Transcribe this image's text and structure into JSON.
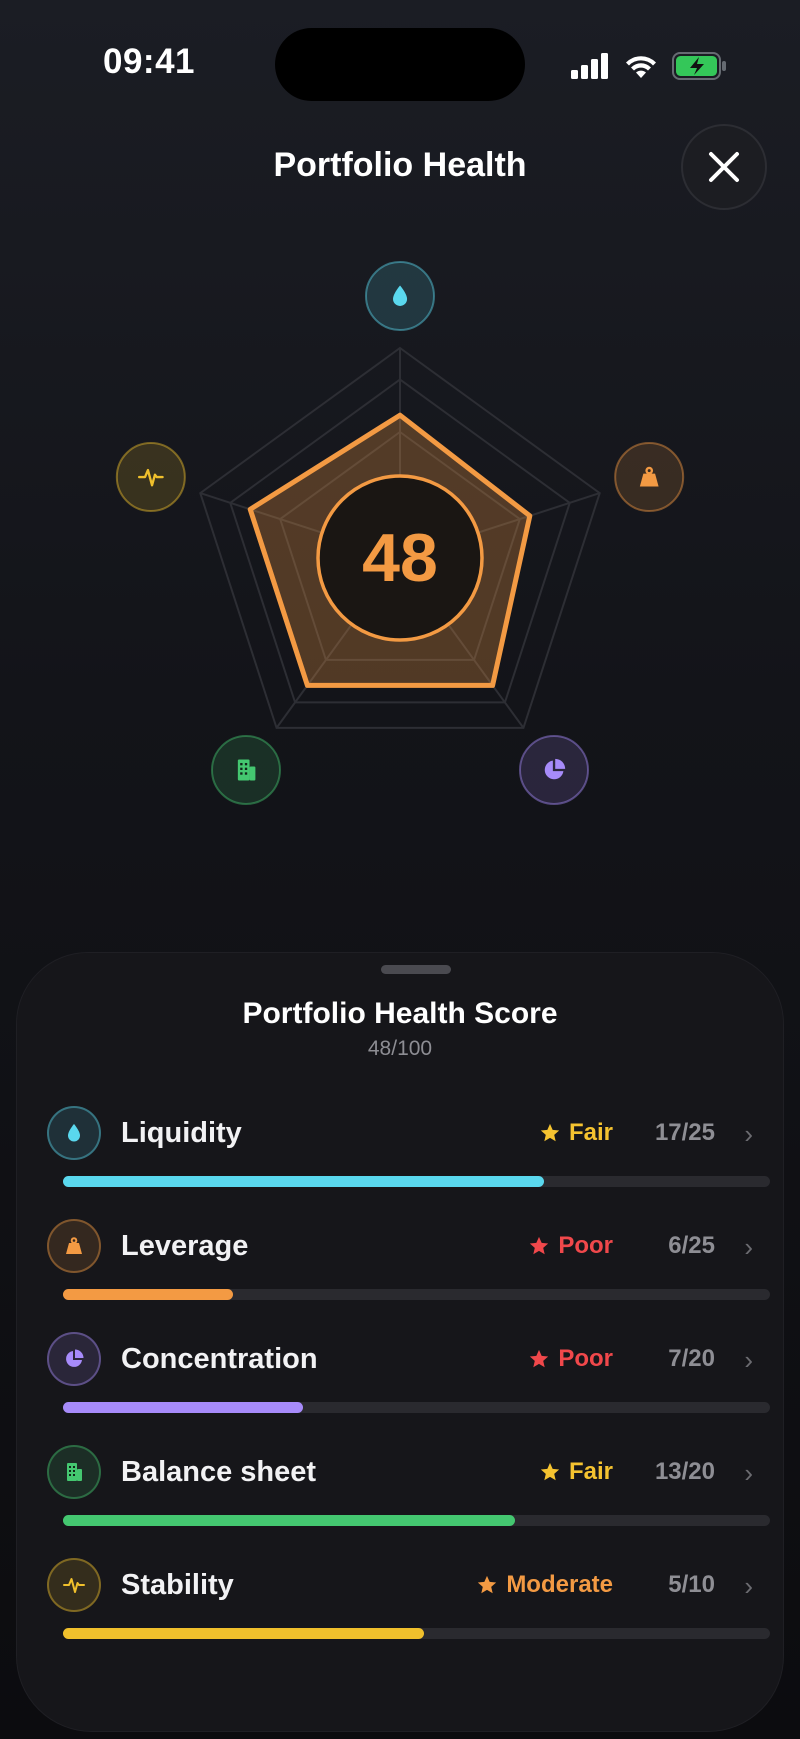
{
  "status": {
    "time": "09:41"
  },
  "header": {
    "title": "Portfolio Health"
  },
  "radar": {
    "score": "48",
    "axes": [
      {
        "name": "Liquidity",
        "icon": "droplet-icon",
        "color": "#5ad8ee",
        "value": 0.68
      },
      {
        "name": "Leverage",
        "icon": "weight-icon",
        "color": "#f39a43",
        "value": 0.65
      },
      {
        "name": "Concentration",
        "icon": "pie-chart-icon",
        "color": "#a78bfa",
        "value": 0.75
      },
      {
        "name": "Balance sheet",
        "icon": "building-icon",
        "color": "#44c770",
        "value": 0.75
      },
      {
        "name": "Stability",
        "icon": "pulse-icon",
        "color": "#f0c02c",
        "value": 0.75
      }
    ]
  },
  "sheet": {
    "title": "Portfolio Health Score",
    "subtitle": "48/100",
    "rows": [
      {
        "label": "Liquidity",
        "rating": "Fair",
        "rating_color": "#f5c330",
        "score": "17/25",
        "fraction": 0.68,
        "color": "#5ad8ee",
        "icon": "droplet-icon"
      },
      {
        "label": "Leverage",
        "rating": "Poor",
        "rating_color": "#f0484b",
        "score": "6/25",
        "fraction": 0.24,
        "color": "#f39a43",
        "icon": "weight-icon"
      },
      {
        "label": "Concentration",
        "rating": "Poor",
        "rating_color": "#f0484b",
        "score": "7/20",
        "fraction": 0.34,
        "color": "#a78bfa",
        "icon": "pie-chart-icon"
      },
      {
        "label": "Balance sheet",
        "rating": "Fair",
        "rating_color": "#f5c330",
        "score": "13/20",
        "fraction": 0.64,
        "color": "#44c770",
        "icon": "building-icon"
      },
      {
        "label": "Stability",
        "rating": "Moderate",
        "rating_color": "#f39a43",
        "score": "5/10",
        "fraction": 0.51,
        "color": "#f0c02c",
        "icon": "pulse-icon"
      }
    ]
  },
  "colors": {
    "accent": "#f39a43",
    "background": "#131419",
    "sheet": "#16161a"
  }
}
